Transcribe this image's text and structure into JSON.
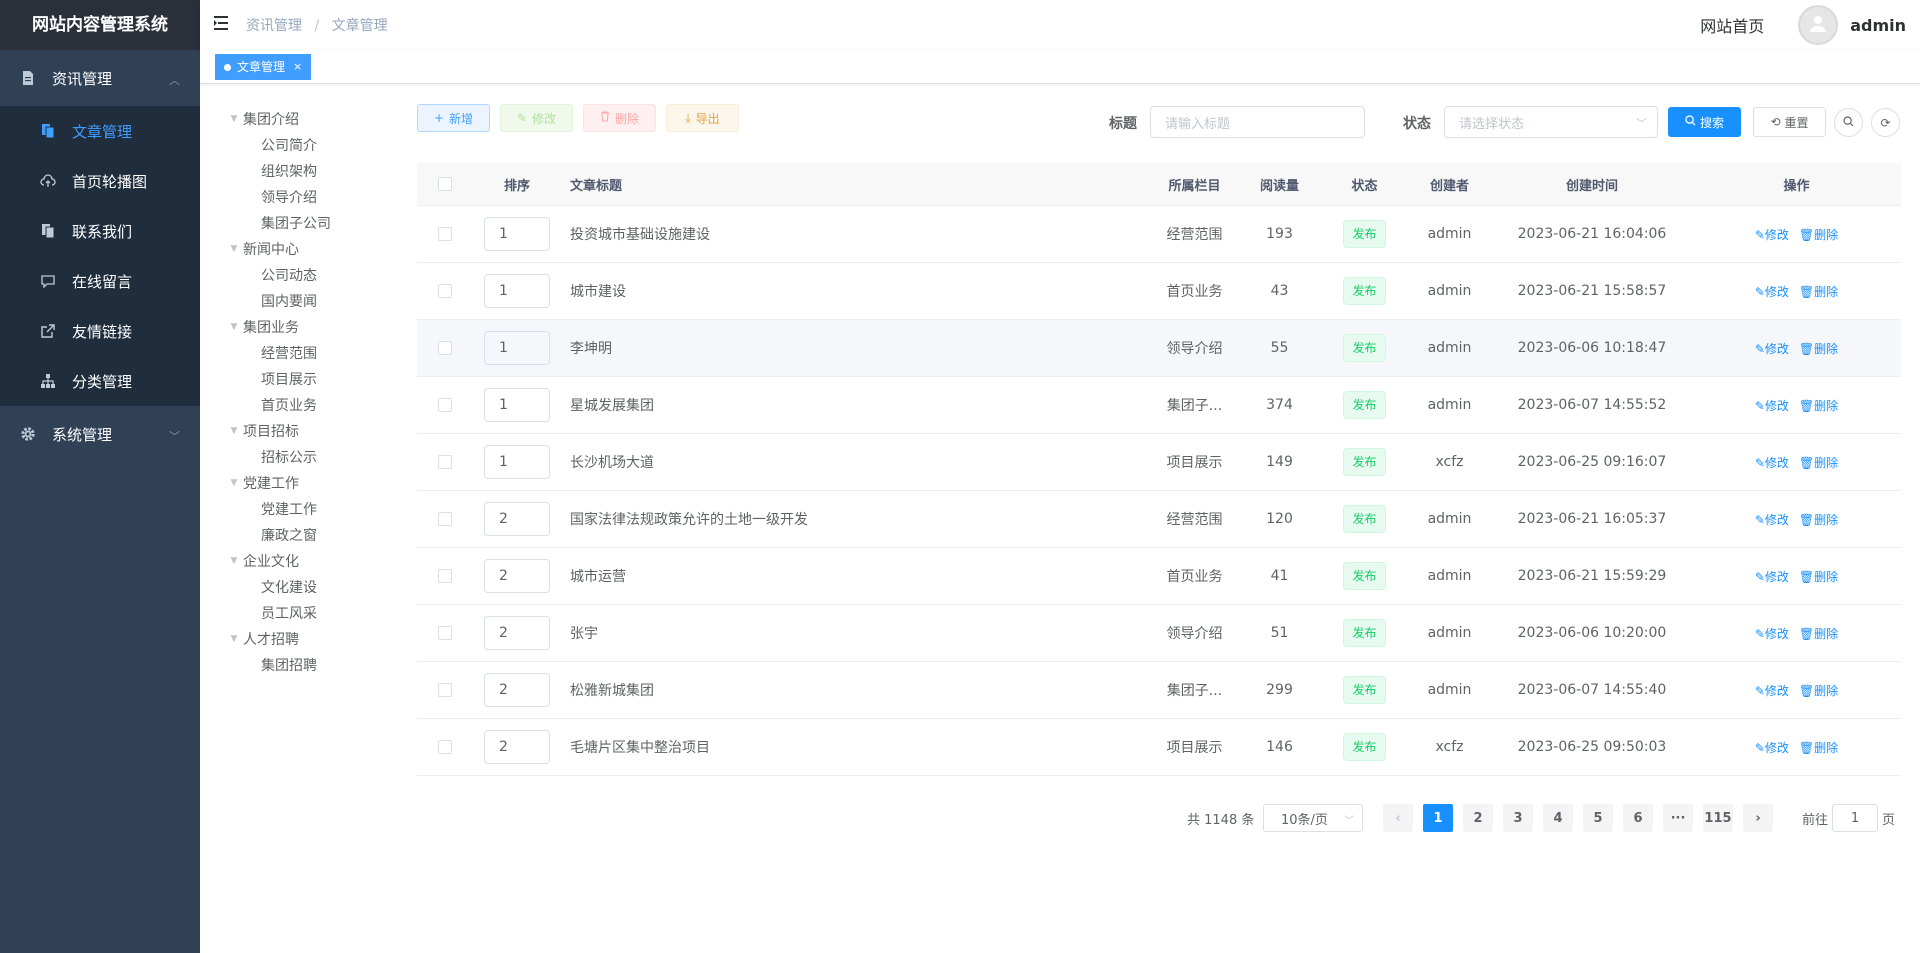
{
  "app": {
    "title": "网站内容管理系统"
  },
  "sidebar": {
    "groups": [
      {
        "label": "资讯管理",
        "icon": "document-icon",
        "expanded": true
      },
      {
        "label": "系统管理",
        "icon": "gear-icon",
        "expanded": false
      }
    ],
    "items": [
      {
        "label": "文章管理",
        "icon": "copy-document-icon",
        "active": true
      },
      {
        "label": "首页轮播图",
        "icon": "cloud-upload-icon"
      },
      {
        "label": "联系我们",
        "icon": "copy-document-icon"
      },
      {
        "label": "在线留言",
        "icon": "chat-icon"
      },
      {
        "label": "友情链接",
        "icon": "external-link-icon"
      },
      {
        "label": "分类管理",
        "icon": "tree-structure-icon"
      }
    ]
  },
  "navbar": {
    "breadcrumb": [
      "资讯管理",
      "文章管理"
    ],
    "home_link": "网站首页",
    "username": "admin"
  },
  "tags": {
    "active_tag": "文章管理"
  },
  "tree": [
    {
      "label": "集团介绍",
      "children": [
        "公司简介",
        "组织架构",
        "领导介绍",
        "集团子公司"
      ]
    },
    {
      "label": "新闻中心",
      "children": [
        "公司动态",
        "国内要闻"
      ]
    },
    {
      "label": "集团业务",
      "children": [
        "经营范围",
        "项目展示",
        "首页业务"
      ]
    },
    {
      "label": "项目招标",
      "children": [
        "招标公示"
      ]
    },
    {
      "label": "党建工作",
      "children": [
        "党建工作",
        "廉政之窗"
      ]
    },
    {
      "label": "企业文化",
      "children": [
        "文化建设",
        "员工风采"
      ]
    },
    {
      "label": "人才招聘",
      "children": [
        "集团招聘"
      ]
    }
  ],
  "toolbar": {
    "add_label": "新增",
    "edit_label": "修改",
    "delete_label": "删除",
    "export_label": "导出"
  },
  "search": {
    "title_label": "标题",
    "title_placeholder": "请输入标题",
    "status_label": "状态",
    "status_placeholder": "请选择状态",
    "search_label": "搜索",
    "reset_label": "重置"
  },
  "table": {
    "columns": [
      "排序",
      "文章标题",
      "所属栏目",
      "阅读量",
      "状态",
      "创建者",
      "创建时间",
      "操作"
    ],
    "edit_label": "修改",
    "delete_label": "删除",
    "rows": [
      {
        "sort": "1",
        "title": "投资城市基础设施建设",
        "column": "经营范围",
        "reads": "193",
        "status": "发布",
        "creator": "admin",
        "time": "2023-06-21 16:04:06"
      },
      {
        "sort": "1",
        "title": "城市建设",
        "column": "首页业务",
        "reads": "43",
        "status": "发布",
        "creator": "admin",
        "time": "2023-06-21 15:58:57"
      },
      {
        "sort": "1",
        "title": "李坤明",
        "column": "领导介绍",
        "reads": "55",
        "status": "发布",
        "creator": "admin",
        "time": "2023-06-06 10:18:47"
      },
      {
        "sort": "1",
        "title": "星城发展集团",
        "column": "集团子...",
        "reads": "374",
        "status": "发布",
        "creator": "admin",
        "time": "2023-06-07 14:55:52"
      },
      {
        "sort": "1",
        "title": "长沙机场大道",
        "column": "项目展示",
        "reads": "149",
        "status": "发布",
        "creator": "xcfz",
        "time": "2023-06-25 09:16:07"
      },
      {
        "sort": "2",
        "title": "国家法律法规政策允许的土地一级开发",
        "column": "经营范围",
        "reads": "120",
        "status": "发布",
        "creator": "admin",
        "time": "2023-06-21 16:05:37"
      },
      {
        "sort": "2",
        "title": "城市运营",
        "column": "首页业务",
        "reads": "41",
        "status": "发布",
        "creator": "admin",
        "time": "2023-06-21 15:59:29"
      },
      {
        "sort": "2",
        "title": "张宇",
        "column": "领导介绍",
        "reads": "51",
        "status": "发布",
        "creator": "admin",
        "time": "2023-06-06 10:20:00"
      },
      {
        "sort": "2",
        "title": "松雅新城集团",
        "column": "集团子...",
        "reads": "299",
        "status": "发布",
        "creator": "admin",
        "time": "2023-06-07 14:55:40"
      },
      {
        "sort": "2",
        "title": "毛塘片区集中整治项目",
        "column": "项目展示",
        "reads": "146",
        "status": "发布",
        "creator": "xcfz",
        "time": "2023-06-25 09:50:03"
      }
    ]
  },
  "pagination": {
    "total_text": "共 1148 条",
    "page_size": "10条/页",
    "pages": [
      "1",
      "2",
      "3",
      "4",
      "5",
      "6",
      "···",
      "115"
    ],
    "current": "1",
    "jump_prefix": "前往",
    "jump_value": "1",
    "jump_suffix": "页"
  },
  "colors": {
    "primary": "#1890ff",
    "sidebar_bg": "#304156",
    "submenu_bg": "#1f2d3d",
    "success": "#13ce66"
  }
}
